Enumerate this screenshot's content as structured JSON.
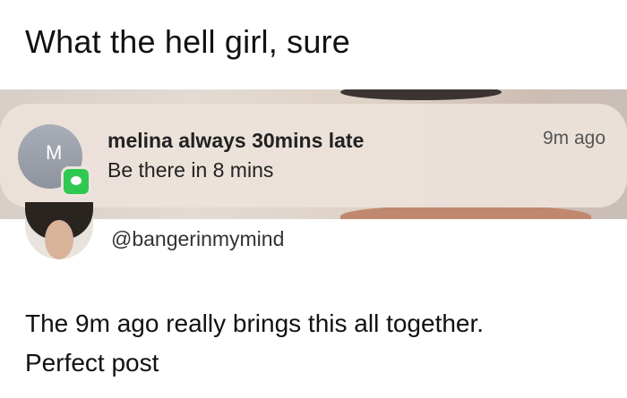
{
  "caption": "What the hell girl, sure",
  "notification": {
    "avatar_letter": "M",
    "sender": "melina always 30mins late",
    "message": "Be there in 8 mins",
    "time": "9m ago",
    "badge_icon": "messages-icon",
    "badge_color": "#2fc951"
  },
  "tweet": {
    "handle": "@bangerinmymind",
    "lines": [
      "The 9m ago really brings this all together.",
      "Perfect post"
    ]
  }
}
